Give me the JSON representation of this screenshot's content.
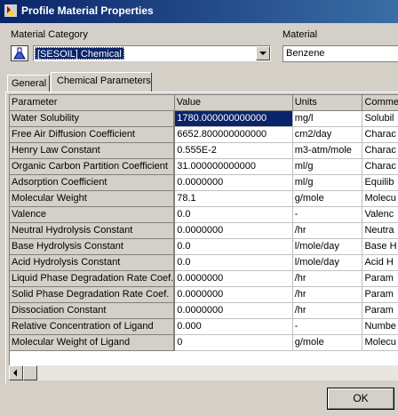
{
  "window": {
    "title": "Profile Material Properties"
  },
  "material_category": {
    "label": "Material Category",
    "value": "[SESOIL] Chemical"
  },
  "material": {
    "label": "Material",
    "value": "Benzene"
  },
  "tabs": [
    {
      "label": "General"
    },
    {
      "label": "Chemical Parameters"
    }
  ],
  "grid": {
    "headers": [
      "Parameter",
      "Value",
      "Units",
      "Comme"
    ],
    "rows": [
      [
        "Water Solubility",
        "1780.000000000000",
        "mg/l",
        "Solubil"
      ],
      [
        "Free Air Diffusion Coefficient",
        "6652.800000000000",
        "cm2/day",
        "Charac"
      ],
      [
        "Henry Law Constant",
        "0.555E-2",
        "m3-atm/mole",
        "Charac"
      ],
      [
        "Organic Carbon Partition Coefficient",
        "31.000000000000",
        "ml/g",
        "Charac"
      ],
      [
        "Adsorption Coefficient",
        "0.0000000",
        "ml/g",
        "Equilib"
      ],
      [
        "Molecular Weight",
        "78.1",
        "g/mole",
        "Molecu"
      ],
      [
        "Valence",
        "0.0",
        "-",
        "Valenc"
      ],
      [
        "Neutral Hydrolysis Constant",
        "0.0000000",
        "/hr",
        "Neutra"
      ],
      [
        "Base Hydrolysis Constant",
        "0.0",
        "l/mole/day",
        "Base H"
      ],
      [
        "Acid Hydrolysis Constant",
        "0.0",
        "l/mole/day",
        "Acid H"
      ],
      [
        "Liquid Phase Degradation Rate Coef.",
        "0.0000000",
        "/hr",
        "Param"
      ],
      [
        "Solid Phase Degradation Rate Coef.",
        "0.0000000",
        "/hr",
        "Param"
      ],
      [
        "Dissociation Constant",
        "0.0000000",
        "/hr",
        "Param"
      ],
      [
        "Relative Concentration of Ligand",
        "0.000",
        "-",
        "Numbe"
      ],
      [
        "Molecular Weight of Ligand",
        "0",
        "g/mole",
        "Molecu"
      ]
    ]
  },
  "ok_button": {
    "label": "OK"
  },
  "colors": {
    "titlebar_start": "#0a246a",
    "titlebar_end": "#3a6ea5",
    "selection": "#0a246a",
    "face": "#d4d0c8"
  }
}
